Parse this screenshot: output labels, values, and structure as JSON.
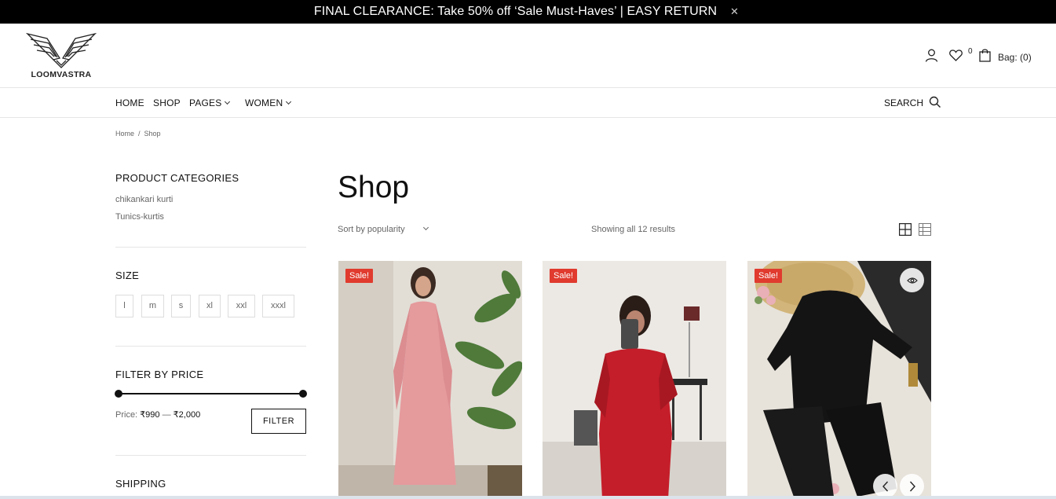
{
  "announcement": {
    "text": "FINAL CLEARANCE: Take 50% off ‘Sale Must-Haves’ | EASY RETURN",
    "close_icon": "close-icon"
  },
  "header": {
    "logo_text": "LOOMVASTRA",
    "wishlist_count": "0",
    "bag_label": "Bag: (0)",
    "icons": [
      "user-icon",
      "heart-icon",
      "bag-icon"
    ]
  },
  "nav": {
    "items": [
      {
        "label": "HOME"
      },
      {
        "label": "SHOP"
      },
      {
        "label": "PAGES"
      },
      {
        "label": "WOMEN"
      }
    ],
    "search_label": "SEARCH"
  },
  "breadcrumb": {
    "home": "Home",
    "separator": "/",
    "current": "Shop"
  },
  "sidebar": {
    "categories_title": "PRODUCT CATEGORIES",
    "categories": [
      "chikankari kurti",
      "Tunics-kurtis"
    ],
    "size_title": "SIZE",
    "sizes": [
      "l",
      "m",
      "s",
      "xl",
      "xxl",
      "xxxl"
    ],
    "price_title": "FILTER BY PRICE",
    "price_prefix": "Price:",
    "price_min": "₹990",
    "price_sep": "—",
    "price_max": "₹2,000",
    "filter_button": "FILTER",
    "shipping_title": "SHIPPING"
  },
  "main": {
    "title": "Shop",
    "sort_label": "Sort by popularity",
    "result_count": "Showing all 12 results",
    "view_icons": [
      "grid-view-icon",
      "list-view-icon"
    ]
  },
  "products": [
    {
      "badge": "Sale!",
      "image": "pink-kurti-photo"
    },
    {
      "badge": "Sale!",
      "image": "red-kurti-photo"
    },
    {
      "badge": "Sale!",
      "image": "black-suit-photo"
    }
  ],
  "colors": {
    "sale_badge": "#e03b2e",
    "announce_bg": "#000000",
    "text": "#222222",
    "muted": "#666666"
  }
}
